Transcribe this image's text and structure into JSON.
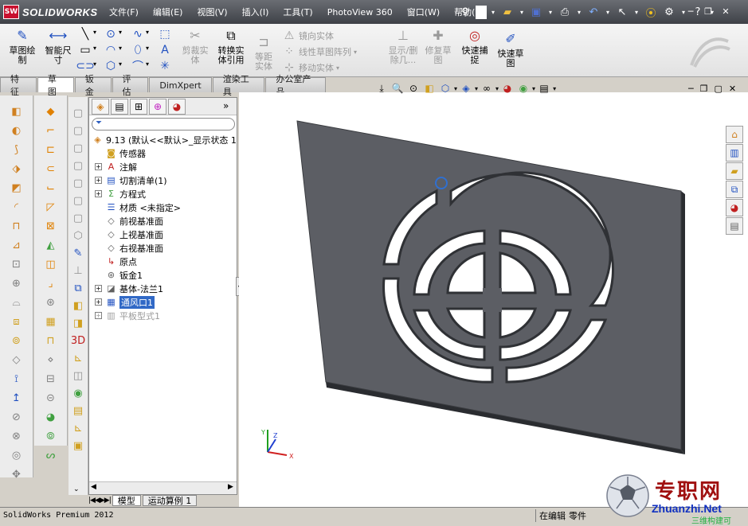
{
  "app": {
    "logo_text": "SOLIDWORKS",
    "logo_box": "SW",
    "product": "SolidWorks Premium 2012"
  },
  "menu": [
    "文件(F)",
    "编辑(E)",
    "视图(V)",
    "插入(I)",
    "工具(T)",
    "PhotoView 360",
    "窗口(W)",
    "帮助(H)"
  ],
  "command_manager": {
    "sketch": "草图绘制",
    "smart_dim": "智能尺寸",
    "trim": "剪裁实体",
    "convert": "转换实体引用",
    "offset": "等距实体",
    "mirror": "镜向实体",
    "linear_pattern": "线性草图阵列",
    "move": "移动实体",
    "display_delete": "显示/删除几...",
    "repair": "修复草图",
    "quick_snap": "快速捕捉",
    "rapid_sketch": "快速草图"
  },
  "tabs": [
    "特征",
    "草图",
    "钣金",
    "评估",
    "DimXpert",
    "渲染工具",
    "办公室产品"
  ],
  "active_tab": "草图",
  "tree": {
    "root": "9.13 (默认<<默认>_显示状态 1",
    "items": [
      {
        "label": "传感器",
        "icon": "sensor-icon",
        "expand": false
      },
      {
        "label": "注解",
        "icon": "annotation-icon",
        "expand": true
      },
      {
        "label": "切割清单(1)",
        "icon": "cutlist-icon",
        "expand": true
      },
      {
        "label": "方程式",
        "icon": "equation-icon",
        "expand": true
      },
      {
        "label": "材质 <未指定>",
        "icon": "material-icon",
        "expand": false
      },
      {
        "label": "前视基准面",
        "icon": "plane-icon",
        "expand": false
      },
      {
        "label": "上视基准面",
        "icon": "plane-icon",
        "expand": false
      },
      {
        "label": "右视基准面",
        "icon": "plane-icon",
        "expand": false
      },
      {
        "label": "原点",
        "icon": "origin-icon",
        "expand": false
      },
      {
        "label": "钣金1",
        "icon": "sheetmetal-icon",
        "expand": false
      },
      {
        "label": "基体-法兰1",
        "icon": "base-flange-icon",
        "expand": true
      },
      {
        "label": "通风口1",
        "icon": "vent-icon",
        "expand": true,
        "selected": true
      },
      {
        "label": "平板型式1",
        "icon": "flat-pattern-icon",
        "expand": true,
        "suppressed": true
      }
    ]
  },
  "bottom_tabs": [
    "模型",
    "运动算例 1"
  ],
  "status": {
    "left": "SolidWorks Premium 2012",
    "editing": "在编辑",
    "mode": "零件"
  },
  "watermark": {
    "text": "专职网",
    "url": "Zhuanzhi.Net",
    "sub": "三维构建可"
  },
  "colors": {
    "part_face": "#5c5e64",
    "part_edge": "#3a3c40",
    "selection": "#3169c6",
    "axis_x": "#d02020",
    "axis_y": "#20a020",
    "axis_z": "#2040d0"
  }
}
